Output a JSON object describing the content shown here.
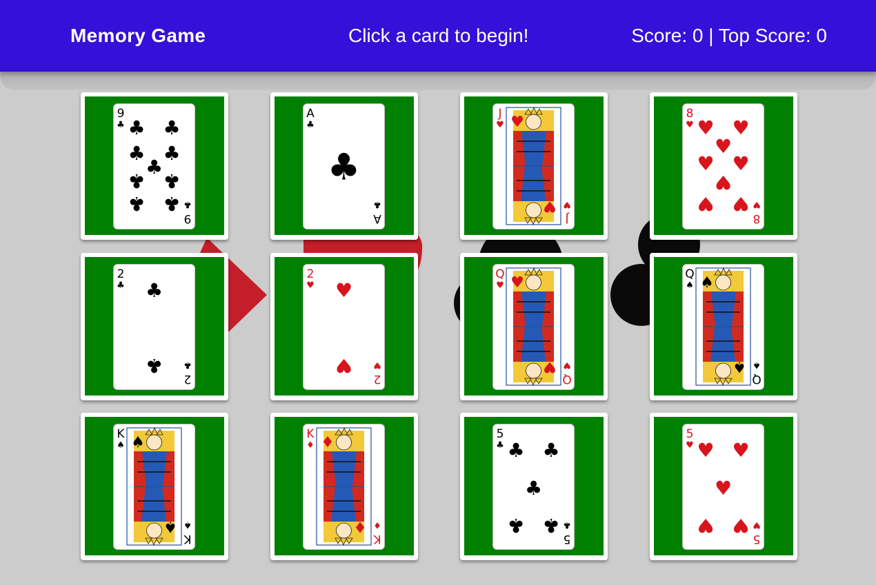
{
  "header": {
    "title": "Memory Game",
    "message": "Click a card to begin!",
    "score_text": "Score: 0 | Top Score: 0"
  },
  "colors": {
    "nav": "#3510d8",
    "felt": "#008000",
    "background": "#cccccc",
    "red_suit": "#d8141c",
    "black_suit": "#000000"
  },
  "cards": [
    {
      "rank": "9",
      "suit": "clubs"
    },
    {
      "rank": "A",
      "suit": "clubs"
    },
    {
      "rank": "J",
      "suit": "hearts"
    },
    {
      "rank": "8",
      "suit": "hearts"
    },
    {
      "rank": "2",
      "suit": "clubs"
    },
    {
      "rank": "2",
      "suit": "hearts"
    },
    {
      "rank": "Q",
      "suit": "hearts"
    },
    {
      "rank": "Q",
      "suit": "spades"
    },
    {
      "rank": "K",
      "suit": "spades"
    },
    {
      "rank": "K",
      "suit": "diamonds"
    },
    {
      "rank": "5",
      "suit": "clubs"
    },
    {
      "rank": "5",
      "suit": "hearts"
    }
  ]
}
